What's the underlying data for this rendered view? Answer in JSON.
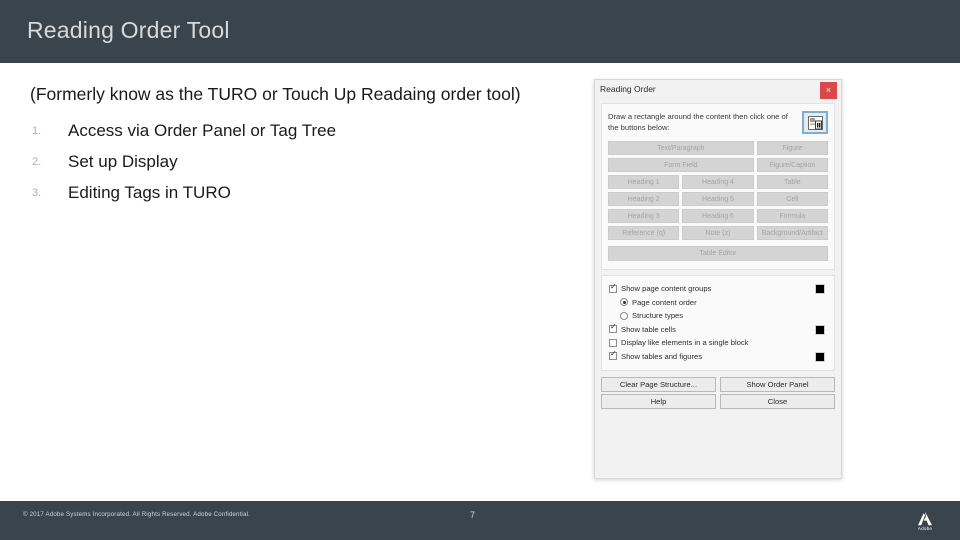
{
  "slide": {
    "title": "Reading Order Tool",
    "subtitle": "(Formerly know as the TURO or Touch Up Readaing order tool)",
    "list": [
      {
        "marker": "1.",
        "text": "Access via Order Panel or Tag Tree"
      },
      {
        "marker": "2.",
        "text": "Set up Display"
      },
      {
        "marker": "3.",
        "text": "Editing Tags in TURO"
      }
    ]
  },
  "footer": {
    "copyright": "© 2017 Adobe Systems Incorporated.  All Rights Reserved.  Adobe Confidential.",
    "page_number": "7",
    "logo_word": "Adobe"
  },
  "dialog": {
    "title": "Reading Order",
    "close_label": "×",
    "instruction": "Draw a rectangle around the content then click one of the buttons below:",
    "tag_buttons": [
      {
        "label": "Text/Paragraph",
        "span": 2
      },
      {
        "label": "Figure",
        "span": 1
      },
      {
        "label": "Form Field",
        "span": 2
      },
      {
        "label": "Figure/Caption",
        "span": 1
      },
      {
        "label": "Heading 1",
        "span": 1
      },
      {
        "label": "Heading 4",
        "span": 1
      },
      {
        "label": "Table",
        "span": 1
      },
      {
        "label": "Heading 2",
        "span": 1
      },
      {
        "label": "Heading 5",
        "span": 1
      },
      {
        "label": "Cell",
        "span": 1
      },
      {
        "label": "Heading 3",
        "span": 1
      },
      {
        "label": "Heading 6",
        "span": 1
      },
      {
        "label": "Formula",
        "span": 1
      },
      {
        "label": "Reference (q)",
        "span": 1
      },
      {
        "label": "Note (z)",
        "span": 1
      },
      {
        "label": "Background/Artifact",
        "span": 1
      }
    ],
    "table_editor_label": "Table Editor",
    "options": [
      {
        "type": "checkbox",
        "label": "Show page content groups",
        "checked": true,
        "indent": false,
        "swatch": true
      },
      {
        "type": "radio",
        "label": "Page content order",
        "checked": true,
        "indent": true,
        "swatch": false
      },
      {
        "type": "radio",
        "label": "Structure types",
        "checked": false,
        "indent": true,
        "swatch": false
      },
      {
        "type": "checkbox",
        "label": "Show table cells",
        "checked": true,
        "indent": false,
        "swatch": true
      },
      {
        "type": "checkbox",
        "label": "Display like elements in a single block",
        "checked": false,
        "indent": false,
        "swatch": false
      },
      {
        "type": "checkbox",
        "label": "Show tables and figures",
        "checked": true,
        "indent": false,
        "swatch": true
      }
    ],
    "footer_buttons": [
      "Clear Page Structure...",
      "Show Order Panel",
      "Help",
      "Close"
    ],
    "swatch_color": "#000000",
    "close_button_color": "#d9484a"
  }
}
